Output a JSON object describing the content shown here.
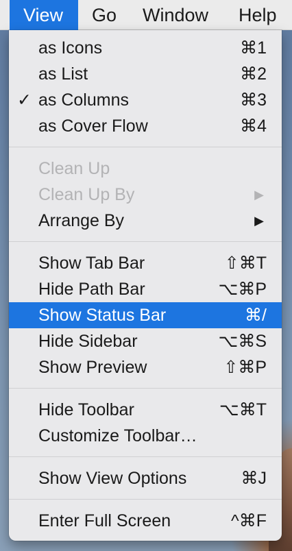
{
  "menubar": {
    "items": [
      {
        "label": "View"
      },
      {
        "label": "Go"
      },
      {
        "label": "Window"
      },
      {
        "label": "Help"
      }
    ]
  },
  "menu": {
    "items": [
      {
        "label": "as Icons",
        "shortcut": "⌘1"
      },
      {
        "label": "as List",
        "shortcut": "⌘2"
      },
      {
        "label": "as Columns",
        "shortcut": "⌘3",
        "check": "✓"
      },
      {
        "label": "as Cover Flow",
        "shortcut": "⌘4"
      },
      {
        "label": "Clean Up"
      },
      {
        "label": "Clean Up By",
        "arrow": "▶"
      },
      {
        "label": "Arrange By",
        "arrow": "▶"
      },
      {
        "label": "Show Tab Bar",
        "shortcut": "⇧⌘T"
      },
      {
        "label": "Hide Path Bar",
        "shortcut": "⌥⌘P"
      },
      {
        "label": "Show Status Bar",
        "shortcut": "⌘/"
      },
      {
        "label": "Hide Sidebar",
        "shortcut": "⌥⌘S"
      },
      {
        "label": "Show Preview",
        "shortcut": "⇧⌘P"
      },
      {
        "label": "Hide Toolbar",
        "shortcut": "⌥⌘T"
      },
      {
        "label": "Customize Toolbar…"
      },
      {
        "label": "Show View Options",
        "shortcut": "⌘J"
      },
      {
        "label": "Enter Full Screen",
        "shortcut": "^⌘F"
      }
    ]
  },
  "colors": {
    "highlight": "#1d75e0",
    "disabled_text": "#b3b3b5"
  }
}
